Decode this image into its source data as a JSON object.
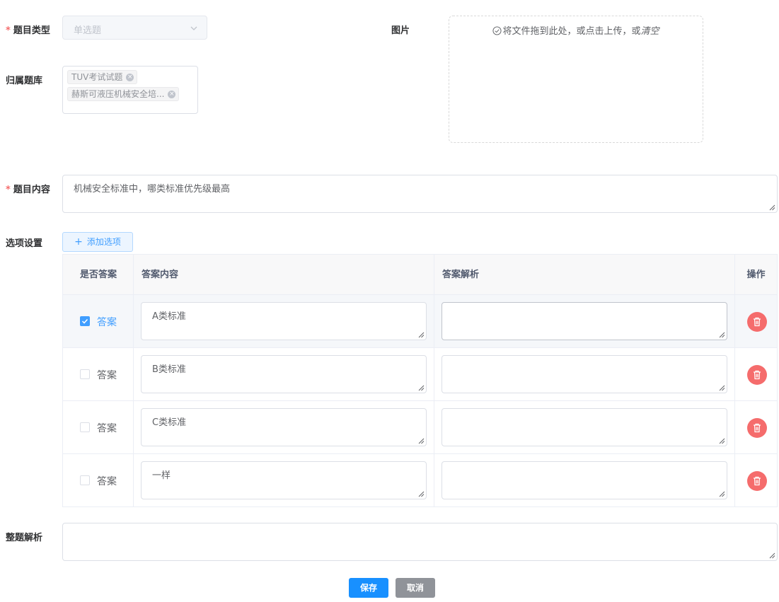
{
  "form": {
    "type_label": "题目类型",
    "type_value": "单选题",
    "bank_label": "归属题库",
    "bank_tags": [
      "TUV考试试题",
      "赫斯可液压机械安全培..."
    ],
    "image_label": "图片",
    "upload_hint_prefix": "将文件拖到此处，或点击上传，或",
    "upload_hint_clear": "清空",
    "content_label": "题目内容",
    "content_value": "机械安全标准中，哪类标准优先级最高",
    "options_label": "选项设置",
    "add_option_label": "添加选项",
    "analysis_label": "整题解析",
    "analysis_value": ""
  },
  "table": {
    "headers": [
      "是否答案",
      "答案内容",
      "答案解析",
      "操作"
    ],
    "rows": [
      {
        "is_answer": true,
        "answer_label": "答案",
        "content": "A类标准",
        "analysis": ""
      },
      {
        "is_answer": false,
        "answer_label": "答案",
        "content": "B类标准",
        "analysis": ""
      },
      {
        "is_answer": false,
        "answer_label": "答案",
        "content": "C类标准",
        "analysis": ""
      },
      {
        "is_answer": false,
        "answer_label": "答案",
        "content": "一样",
        "analysis": ""
      }
    ]
  },
  "actions": {
    "save_label": "保存",
    "cancel_label": "取消"
  },
  "colors": {
    "primary": "#409eff",
    "danger": "#f56c6c",
    "save": "#1890ff",
    "cancel": "#909399"
  },
  "icons": {
    "select_arrow": "chevron-down-icon",
    "tag_close": "close-circle-icon",
    "upload": "check-circle-icon",
    "add": "plus-icon",
    "delete": "trash-icon",
    "check": "checkmark-icon"
  }
}
